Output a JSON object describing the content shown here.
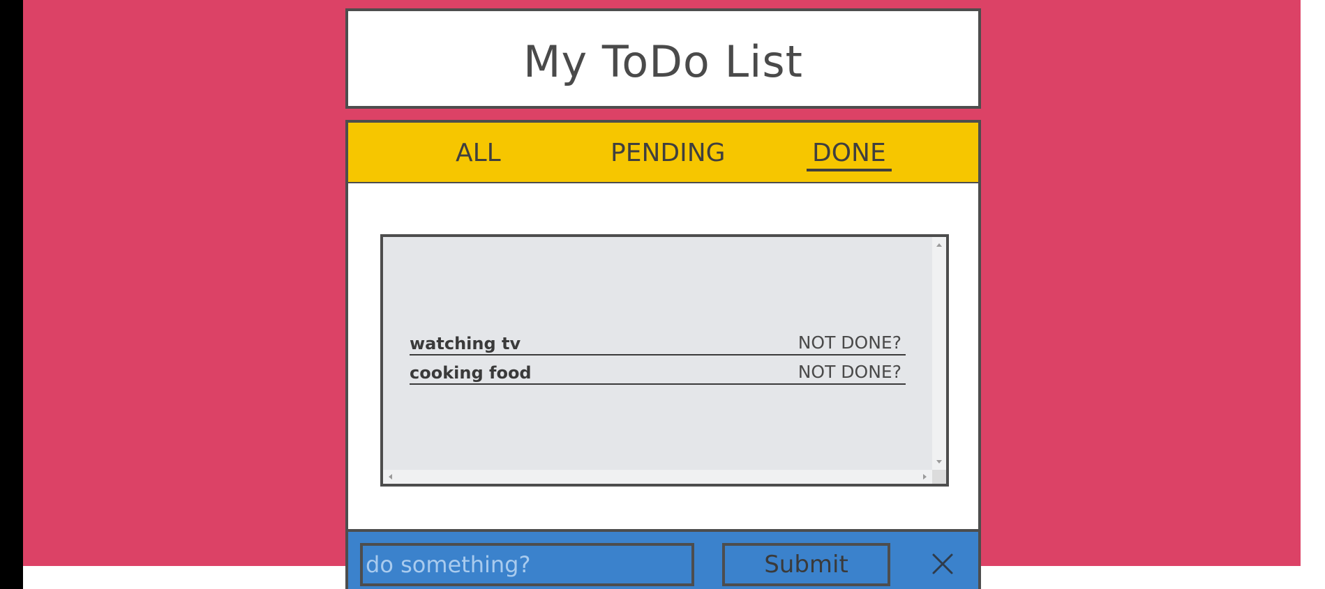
{
  "app": {
    "title": "My ToDo List"
  },
  "tabs": [
    {
      "label": "ALL",
      "active": false
    },
    {
      "label": "PENDING",
      "active": false
    },
    {
      "label": "DONE",
      "active": true
    }
  ],
  "todos": [
    {
      "text": "watching tv",
      "action": "NOT DONE?"
    },
    {
      "text": "cooking food",
      "action": "NOT DONE?"
    }
  ],
  "footer": {
    "input_placeholder": "do something?",
    "input_value": "",
    "submit_label": "Submit",
    "clear_icon": "close-icon"
  },
  "colors": {
    "background": "#dc4266",
    "tab_bar": "#f6c600",
    "footer": "#3b82cc",
    "list_background": "#e4e6e9",
    "border": "#4d4d4d"
  }
}
